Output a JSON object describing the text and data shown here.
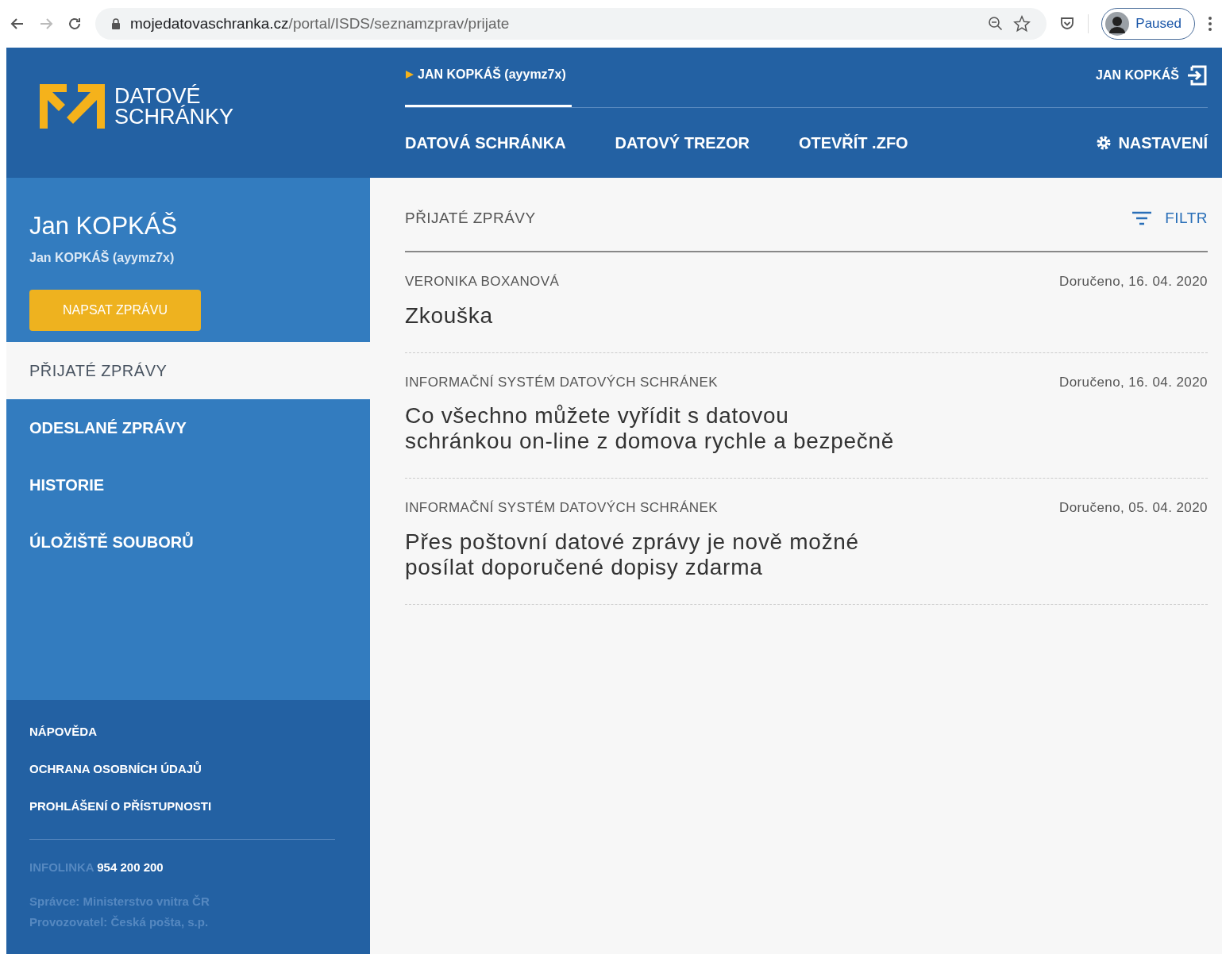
{
  "browser": {
    "url_domain": "mojedatovaschranka.cz",
    "url_path": "/portal/ISDS/seznamzprav/prijate",
    "profile_status": "Paused"
  },
  "header": {
    "logo_lines": [
      "DATOVÉ",
      "SCHRÁNKY"
    ],
    "boxes": [
      {
        "label": "JAN KOPKÁŠ (ayymz7x)",
        "selected": true
      }
    ],
    "user": "JAN KOPKÁŠ",
    "nav": [
      "DATOVÁ SCHRÁNKA",
      "DATOVÝ TREZOR",
      "OTEVŘÍT .ZFO"
    ],
    "settings": "NASTAVENÍ"
  },
  "sidebar": {
    "name": "Jan KOPKÁŠ",
    "account": "Jan KOPKÁŠ (ayymz7x)",
    "compose": "NAPSAT ZPRÁVU",
    "items": [
      {
        "label": "PŘIJATÉ ZPRÁVY",
        "selected": true
      },
      {
        "label": "ODESLANÉ ZPRÁVY",
        "selected": false
      },
      {
        "label": "HISTORIE",
        "selected": false
      },
      {
        "label": "ÚLOŽIŠTĚ SOUBORŮ",
        "selected": false
      }
    ],
    "footer_links": [
      "NÁPOVĚDA",
      "OCHRANA OSOBNÍCH ÚDAJŮ",
      "PROHLÁŠENÍ O PŘÍSTUPNOSTI"
    ],
    "hotline_label": "INFOLINKA",
    "hotline_number": "954 200 200",
    "credits": [
      "Správce: Ministerstvo vnitra ČR",
      "Provozovatel: Česká pošta, s.p."
    ]
  },
  "main": {
    "title": "PŘIJATÉ ZPRÁVY",
    "filter": "FILTR",
    "messages": [
      {
        "sender": "VERONIKA BOXANOVÁ",
        "date": "Doručeno, 16. 04. 2020",
        "subject": [
          "Zkouška"
        ]
      },
      {
        "sender": "INFORMAČNÍ SYSTÉM DATOVÝCH SCHRÁNEK",
        "date": "Doručeno, 16. 04. 2020",
        "subject": [
          "Co všechno můžete vyřídit s datovou",
          "schránkou on-line z domova rychle a bezpečně"
        ]
      },
      {
        "sender": "INFORMAČNÍ SYSTÉM DATOVÝCH SCHRÁNEK",
        "date": "Doručeno, 05. 04. 2020",
        "subject": [
          "Přes poštovní datové zprávy je nově možné",
          "posílat doporučené dopisy zdarma"
        ]
      }
    ]
  }
}
